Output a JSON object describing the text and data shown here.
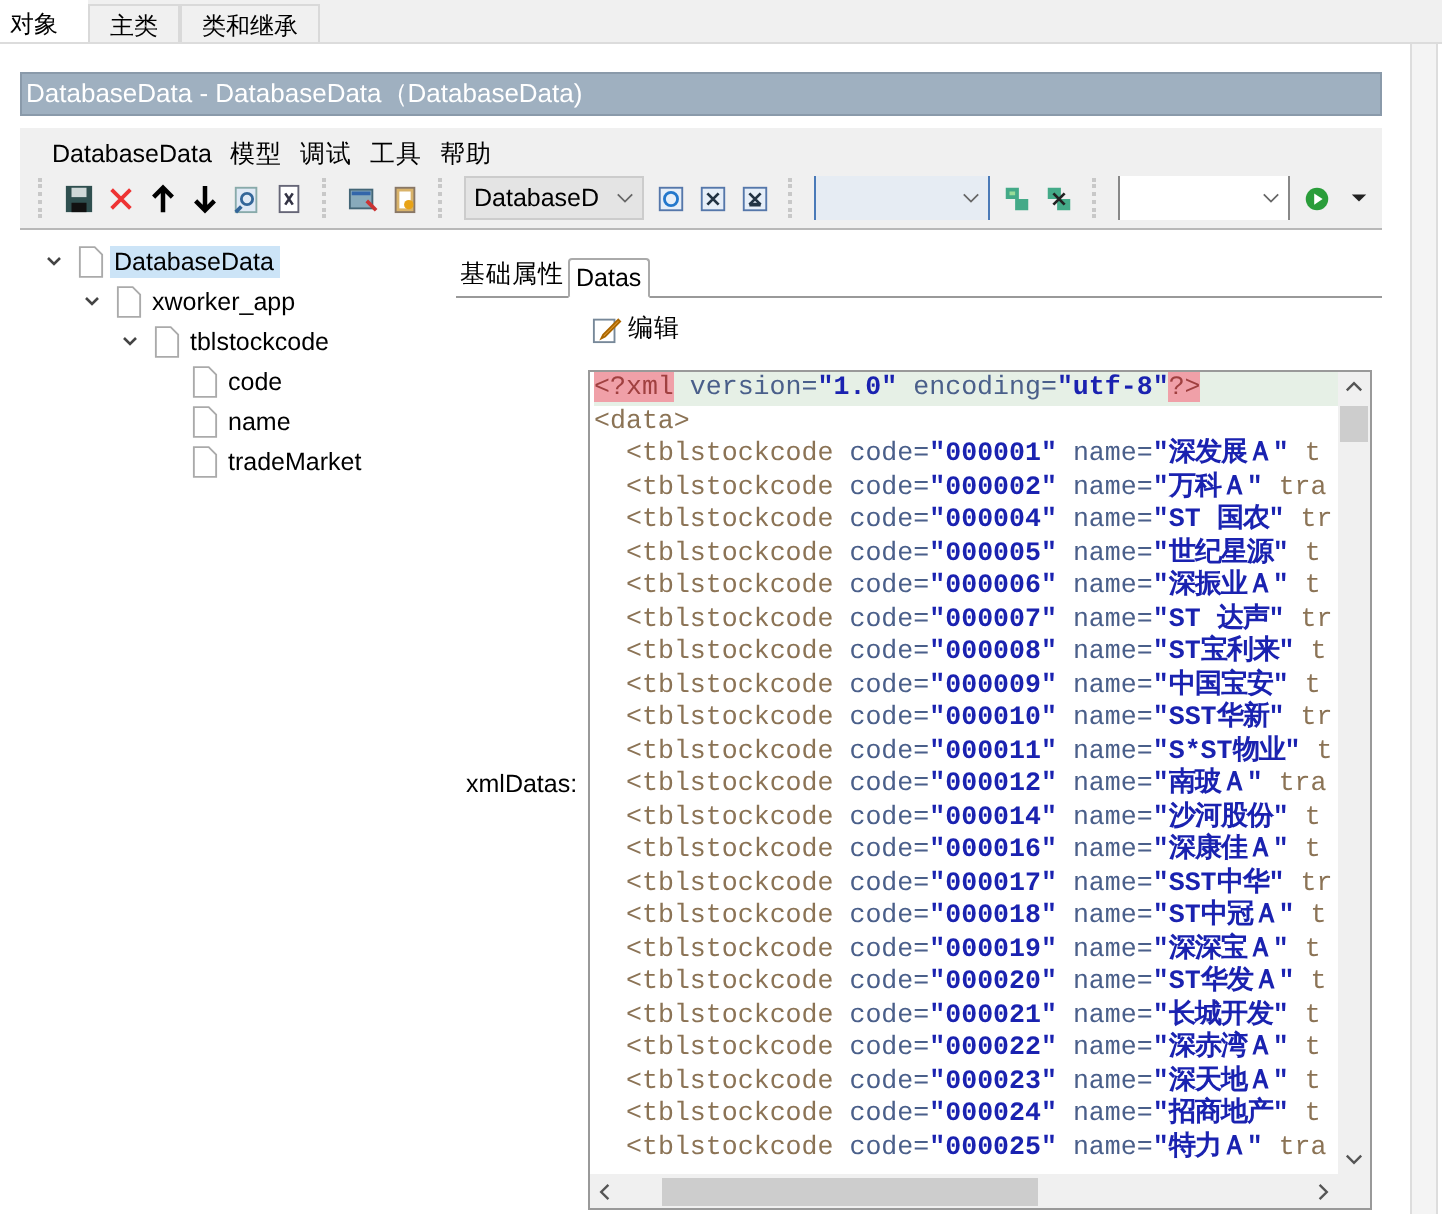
{
  "top_tabs": [
    {
      "label": "对象",
      "selected": true
    },
    {
      "label": "主类",
      "selected": false
    },
    {
      "label": "类和继承",
      "selected": false
    }
  ],
  "title": "DatabaseData - DatabaseData（DatabaseData)",
  "menu": [
    "DatabaseData",
    "模型",
    "调试",
    "工具",
    "帮助"
  ],
  "toolbar": {
    "model_combo": "DatabaseD"
  },
  "tree": [
    {
      "label": "DatabaseData",
      "selected": true,
      "expanded": true,
      "children": [
        {
          "label": "xworker_app",
          "selected": false,
          "expanded": true,
          "children": [
            {
              "label": "tblstockcode",
              "selected": false,
              "expanded": true,
              "children": [
                {
                  "label": "code",
                  "selected": false
                },
                {
                  "label": "name",
                  "selected": false
                },
                {
                  "label": "tradeMarket",
                  "selected": false
                }
              ]
            }
          ]
        }
      ]
    }
  ],
  "sub_tabs": [
    {
      "label": "基础属性",
      "selected": false
    },
    {
      "label": "Datas",
      "selected": true
    }
  ],
  "edit_button": "编辑",
  "field_label": "xmlDatas:",
  "xml": {
    "declaration": {
      "open": "<?xml",
      "attrs": [
        {
          "name": "version=",
          "value": "\"1.0\""
        },
        {
          "name": "encoding=",
          "value": "\"utf-8\""
        }
      ],
      "close": "?>"
    },
    "root": "<data>",
    "rows": [
      {
        "tag": "<tblstockcode",
        "code_attr": "code=",
        "code": "\"000001\"",
        "name_attr": "name=",
        "name": "\"深发展Ａ\"",
        "tail": "t"
      },
      {
        "tag": "<tblstockcode",
        "code_attr": "code=",
        "code": "\"000002\"",
        "name_attr": "name=",
        "name": "\"万科Ａ\"",
        "tail": "tra"
      },
      {
        "tag": "<tblstockcode",
        "code_attr": "code=",
        "code": "\"000004\"",
        "name_attr": "name=",
        "name": "\"ST 国农\"",
        "tail": "tr"
      },
      {
        "tag": "<tblstockcode",
        "code_attr": "code=",
        "code": "\"000005\"",
        "name_attr": "name=",
        "name": "\"世纪星源\"",
        "tail": "t"
      },
      {
        "tag": "<tblstockcode",
        "code_attr": "code=",
        "code": "\"000006\"",
        "name_attr": "name=",
        "name": "\"深振业Ａ\"",
        "tail": "t"
      },
      {
        "tag": "<tblstockcode",
        "code_attr": "code=",
        "code": "\"000007\"",
        "name_attr": "name=",
        "name": "\"ST 达声\"",
        "tail": "tr"
      },
      {
        "tag": "<tblstockcode",
        "code_attr": "code=",
        "code": "\"000008\"",
        "name_attr": "name=",
        "name": "\"ST宝利来\"",
        "tail": "t"
      },
      {
        "tag": "<tblstockcode",
        "code_attr": "code=",
        "code": "\"000009\"",
        "name_attr": "name=",
        "name": "\"中国宝安\"",
        "tail": "t"
      },
      {
        "tag": "<tblstockcode",
        "code_attr": "code=",
        "code": "\"000010\"",
        "name_attr": "name=",
        "name": "\"SST华新\"",
        "tail": "tr"
      },
      {
        "tag": "<tblstockcode",
        "code_attr": "code=",
        "code": "\"000011\"",
        "name_attr": "name=",
        "name": "\"S*ST物业\"",
        "tail": "t"
      },
      {
        "tag": "<tblstockcode",
        "code_attr": "code=",
        "code": "\"000012\"",
        "name_attr": "name=",
        "name": "\"南玻Ａ\"",
        "tail": "tra"
      },
      {
        "tag": "<tblstockcode",
        "code_attr": "code=",
        "code": "\"000014\"",
        "name_attr": "name=",
        "name": "\"沙河股份\"",
        "tail": "t"
      },
      {
        "tag": "<tblstockcode",
        "code_attr": "code=",
        "code": "\"000016\"",
        "name_attr": "name=",
        "name": "\"深康佳Ａ\"",
        "tail": "t"
      },
      {
        "tag": "<tblstockcode",
        "code_attr": "code=",
        "code": "\"000017\"",
        "name_attr": "name=",
        "name": "\"SST中华\"",
        "tail": "tr"
      },
      {
        "tag": "<tblstockcode",
        "code_attr": "code=",
        "code": "\"000018\"",
        "name_attr": "name=",
        "name": "\"ST中冠Ａ\"",
        "tail": "t"
      },
      {
        "tag": "<tblstockcode",
        "code_attr": "code=",
        "code": "\"000019\"",
        "name_attr": "name=",
        "name": "\"深深宝Ａ\"",
        "tail": "t"
      },
      {
        "tag": "<tblstockcode",
        "code_attr": "code=",
        "code": "\"000020\"",
        "name_attr": "name=",
        "name": "\"ST华发Ａ\"",
        "tail": "t"
      },
      {
        "tag": "<tblstockcode",
        "code_attr": "code=",
        "code": "\"000021\"",
        "name_attr": "name=",
        "name": "\"长城开发\"",
        "tail": "t"
      },
      {
        "tag": "<tblstockcode",
        "code_attr": "code=",
        "code": "\"000022\"",
        "name_attr": "name=",
        "name": "\"深赤湾Ａ\"",
        "tail": "t"
      },
      {
        "tag": "<tblstockcode",
        "code_attr": "code=",
        "code": "\"000023\"",
        "name_attr": "name=",
        "name": "\"深天地Ａ\"",
        "tail": "t"
      },
      {
        "tag": "<tblstockcode",
        "code_attr": "code=",
        "code": "\"000024\"",
        "name_attr": "name=",
        "name": "\"招商地产\"",
        "tail": "t"
      },
      {
        "tag": "<tblstockcode",
        "code_attr": "code=",
        "code": "\"000025\"",
        "name_attr": "name=",
        "name": "\"特力Ａ\"",
        "tail": "tra"
      }
    ]
  }
}
